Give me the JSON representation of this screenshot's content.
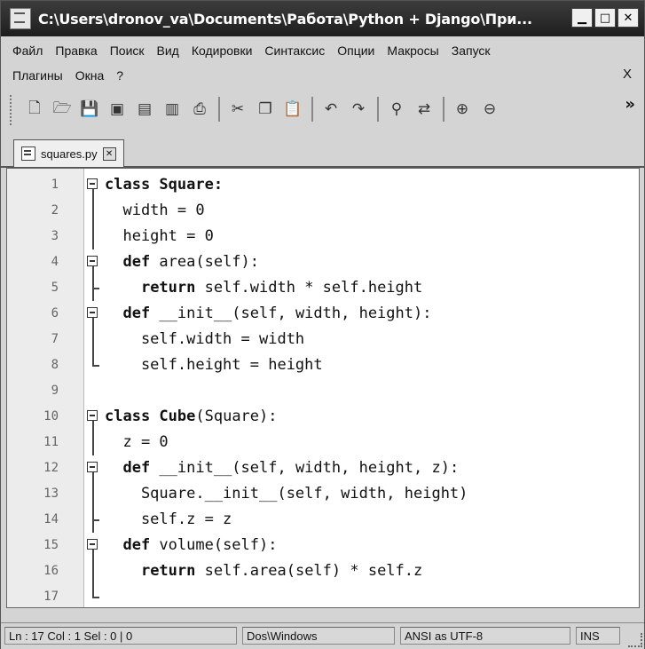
{
  "window": {
    "title": "C:\\Users\\dronov_va\\Documents\\Работа\\Python + Django\\При...",
    "min_label": "▁",
    "max_label": "□",
    "close_label": "✕"
  },
  "menu": {
    "items": [
      "Файл",
      "Правка",
      "Поиск",
      "Вид",
      "Кодировки",
      "Синтаксис",
      "Опции",
      "Макросы",
      "Запуск",
      "Плагины",
      "Окна",
      "?"
    ],
    "close": "X"
  },
  "toolbar": {
    "icons": [
      "new-file-icon",
      "open-file-icon",
      "save-icon",
      "save-all-icon",
      "close-icon",
      "close-all-icon",
      "print-icon",
      "cut-icon",
      "copy-icon",
      "paste-icon",
      "undo-icon",
      "redo-icon",
      "find-icon",
      "replace-icon",
      "zoom-in-icon",
      "zoom-out-icon"
    ],
    "more": "»"
  },
  "tab": {
    "label": "squares.py",
    "close": "✕"
  },
  "editor": {
    "lines": [
      {
        "n": "1",
        "fold": "box",
        "tokens": [
          {
            "t": "class ",
            "c": "kw"
          },
          {
            "t": "Square",
            "c": "kw"
          },
          {
            "t": ":",
            "c": "kw"
          }
        ]
      },
      {
        "n": "2",
        "fold": "line",
        "tokens": [
          {
            "t": "  width = 0",
            "c": "n"
          }
        ]
      },
      {
        "n": "3",
        "fold": "line",
        "tokens": [
          {
            "t": "  height = 0",
            "c": "n"
          }
        ]
      },
      {
        "n": "4",
        "fold": "box",
        "tokens": [
          {
            "t": "  def ",
            "c": "kw"
          },
          {
            "t": "area(self):",
            "c": "n"
          }
        ]
      },
      {
        "n": "5",
        "fold": "tick",
        "tokens": [
          {
            "t": "    ",
            "c": "n"
          },
          {
            "t": "return ",
            "c": "kw"
          },
          {
            "t": "self.width * self.height",
            "c": "n"
          }
        ]
      },
      {
        "n": "6",
        "fold": "box",
        "tokens": [
          {
            "t": "  def ",
            "c": "kw"
          },
          {
            "t": "__init__(self, width, height):",
            "c": "n"
          }
        ]
      },
      {
        "n": "7",
        "fold": "line",
        "tokens": [
          {
            "t": "    self.width = width",
            "c": "n"
          }
        ]
      },
      {
        "n": "8",
        "fold": "end",
        "tokens": [
          {
            "t": "    self.height = height",
            "c": "n"
          }
        ]
      },
      {
        "n": "9",
        "fold": "none",
        "tokens": [
          {
            "t": "",
            "c": "n"
          }
        ]
      },
      {
        "n": "10",
        "fold": "box",
        "tokens": [
          {
            "t": "class ",
            "c": "kw"
          },
          {
            "t": "Cube",
            "c": "kw"
          },
          {
            "t": "(Square):",
            "c": "n"
          }
        ]
      },
      {
        "n": "11",
        "fold": "line",
        "tokens": [
          {
            "t": "  z = 0",
            "c": "n"
          }
        ]
      },
      {
        "n": "12",
        "fold": "box",
        "tokens": [
          {
            "t": "  def ",
            "c": "kw"
          },
          {
            "t": "__init__(self, width, height, z):",
            "c": "n"
          }
        ]
      },
      {
        "n": "13",
        "fold": "line",
        "tokens": [
          {
            "t": "    Square.__init__(self, width, height)",
            "c": "n"
          }
        ]
      },
      {
        "n": "14",
        "fold": "tick",
        "tokens": [
          {
            "t": "    self.z = z",
            "c": "n"
          }
        ]
      },
      {
        "n": "15",
        "fold": "box",
        "tokens": [
          {
            "t": "  def ",
            "c": "kw"
          },
          {
            "t": "volume(self):",
            "c": "n"
          }
        ]
      },
      {
        "n": "16",
        "fold": "line",
        "tokens": [
          {
            "t": "    ",
            "c": "n"
          },
          {
            "t": "return ",
            "c": "kw"
          },
          {
            "t": "self.area(self) * self.z",
            "c": "n"
          }
        ]
      },
      {
        "n": "17",
        "fold": "end",
        "tokens": [
          {
            "t": "",
            "c": "n"
          }
        ]
      }
    ]
  },
  "status": {
    "pos": "Ln : 17    Col : 1    Sel : 0 | 0",
    "eol": "Dos\\Windows",
    "encoding": "ANSI as UTF-8",
    "mode": "INS"
  }
}
